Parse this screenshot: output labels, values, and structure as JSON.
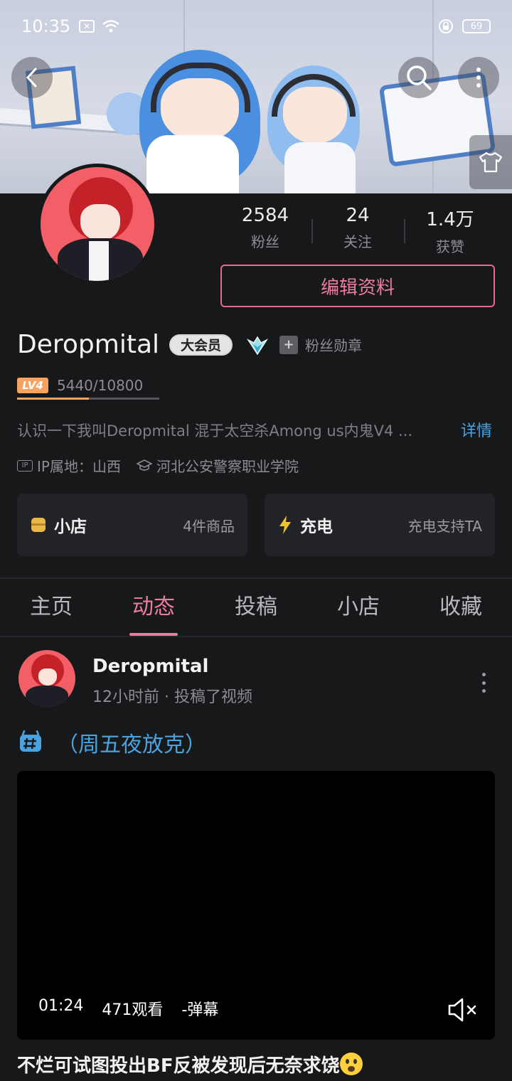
{
  "status_bar": {
    "time": "10:35",
    "battery": "69"
  },
  "profile": {
    "stats": [
      {
        "value": "2584",
        "label": "粉丝"
      },
      {
        "value": "24",
        "label": "关注"
      },
      {
        "value": "1.4万",
        "label": "获赞"
      }
    ],
    "edit_label": "编辑资料",
    "name": "Deropmital",
    "vip_label": "大会员",
    "fan_badge_label": "粉丝勋章",
    "level": "LV4",
    "exp_text": "5440/10800",
    "exp_progress": 0.504,
    "bio": "认识一下我叫Deropmital 混于太空杀Among us内鬼V4 ...",
    "detail_label": "详情",
    "ip_tag": "IP",
    "ip_location": "IP属地：山西",
    "school": "河北公安警察职业学院"
  },
  "cards": [
    {
      "icon": "shop-icon",
      "title": "小店",
      "sub": "4件商品"
    },
    {
      "icon": "lightning-icon",
      "title": "充电",
      "sub": "充电支持TA"
    }
  ],
  "tabs": [
    {
      "label": "主页",
      "active": false
    },
    {
      "label": "动态",
      "active": true
    },
    {
      "label": "投稿",
      "active": false
    },
    {
      "label": "小店",
      "active": false
    },
    {
      "label": "收藏",
      "active": false
    }
  ],
  "post": {
    "author": "Deropmital",
    "meta": "12小时前 · 投稿了视频",
    "topic": "（周五夜放克）",
    "duration": "01:24",
    "views": "471观看",
    "danmaku": "-弹幕",
    "title": "不烂可试图投出BF反被发现后无奈求饶"
  },
  "colors": {
    "accent_pink": "#f07aa2",
    "link_blue": "#4aa3e0",
    "level_orange": "#f6a361"
  }
}
